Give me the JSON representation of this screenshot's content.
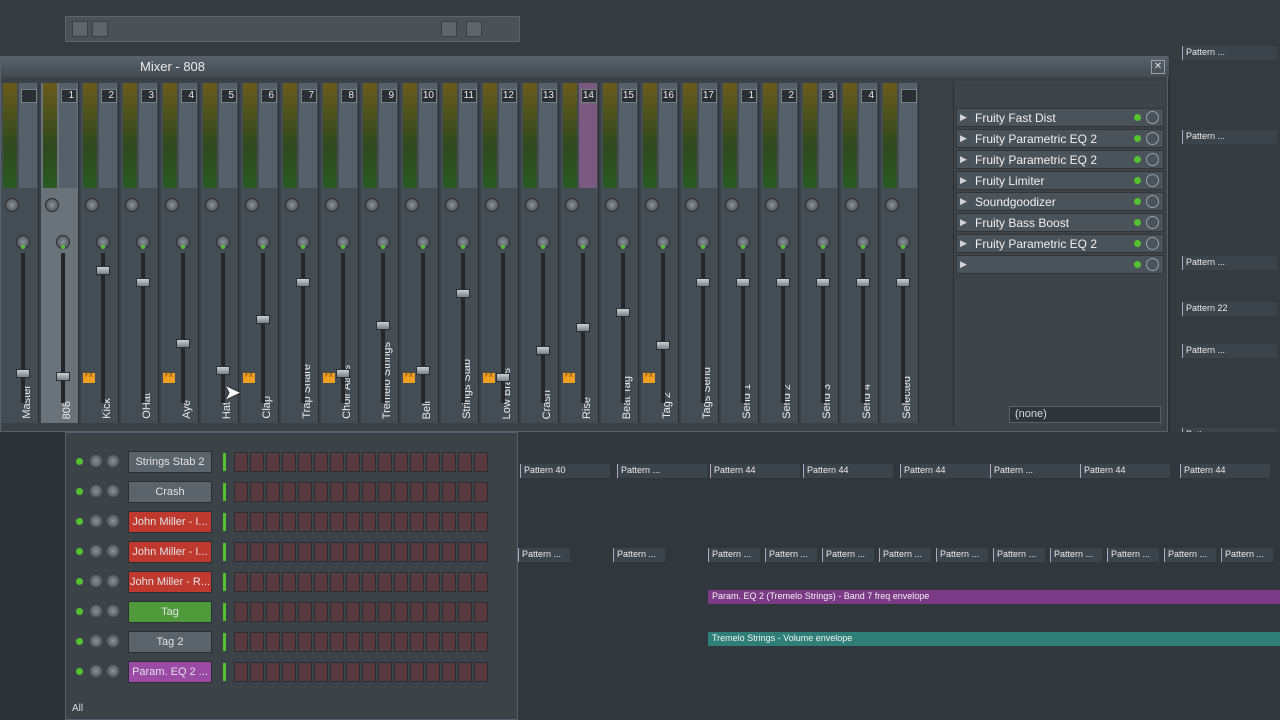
{
  "mixer": {
    "title": "Mixer - 808",
    "close_icon": "close-icon",
    "strips": [
      {
        "num": "",
        "name": "Master",
        "level": 0.2
      },
      {
        "num": "1",
        "name": "808",
        "level": 0.18
      },
      {
        "num": "2",
        "name": "Kick",
        "level": 0.91
      },
      {
        "num": "3",
        "name": "OHat",
        "level": 0.83
      },
      {
        "num": "4",
        "name": "Aye",
        "level": 0.41
      },
      {
        "num": "5",
        "name": "Hat",
        "level": 0.22
      },
      {
        "num": "6",
        "name": "Clap",
        "level": 0.57
      },
      {
        "num": "7",
        "name": "Trap Snare",
        "level": 0.83
      },
      {
        "num": "8",
        "name": "Choir Aahs",
        "level": 0.2
      },
      {
        "num": "9",
        "name": "Tremelo Strings",
        "level": 0.53
      },
      {
        "num": "10",
        "name": "Bell",
        "level": 0.22
      },
      {
        "num": "11",
        "name": "Strings Stab",
        "level": 0.75
      },
      {
        "num": "12",
        "name": "Low Brass",
        "level": 0.17
      },
      {
        "num": "13",
        "name": "Crash",
        "level": 0.36
      },
      {
        "num": "14",
        "name": "Rise",
        "level": 0.52
      },
      {
        "num": "15",
        "name": "Beat Tag",
        "level": 0.62
      },
      {
        "num": "16",
        "name": "Tag 2",
        "level": 0.39
      },
      {
        "num": "17",
        "name": "Tags Send",
        "level": 0.83
      },
      {
        "num": "1",
        "name": "Send 1",
        "level": 0.83
      },
      {
        "num": "2",
        "name": "Send 2",
        "level": 0.83
      },
      {
        "num": "3",
        "name": "Send 3",
        "level": 0.83
      },
      {
        "num": "4",
        "name": "Send 4",
        "level": 0.83
      },
      {
        "num": "",
        "name": "Selected",
        "level": 0.83
      }
    ],
    "fx_slots": [
      "Fruity Fast Dist",
      "Fruity Parametric EQ 2",
      "Fruity Parametric EQ 2",
      "Fruity Limiter",
      "Soundgoodizer",
      "Fruity Bass Boost",
      "Fruity Parametric EQ 2",
      ""
    ],
    "output": "(none)",
    "accent": "#f0a020"
  },
  "channel_rack": {
    "rows": [
      {
        "name": "Strings Stab 2",
        "color": "#5c646b"
      },
      {
        "name": "Crash",
        "color": "#5c646b"
      },
      {
        "name": "John Miller - I...",
        "color": "#c0392f"
      },
      {
        "name": "John Miller - I...",
        "color": "#c0392f"
      },
      {
        "name": "John Miller - R...",
        "color": "#c0392f"
      },
      {
        "name": "Tag",
        "color": "#4f9a3a"
      },
      {
        "name": "Tag 2",
        "color": "#5c646b"
      },
      {
        "name": "Param. EQ 2 ...",
        "color": "#9b4aa6"
      }
    ],
    "filter": "All"
  },
  "playlist": {
    "patterns_row1": [
      "Pattern 40",
      "Pattern ...",
      "Pattern 44",
      "Pattern 44",
      "Pattern 44",
      "Pattern ...",
      "Pattern 44",
      "Pattern 44"
    ],
    "patterns_row2": [
      "Pattern ...",
      "Pattern ...",
      "Pattern ...",
      "Pattern ...",
      "Pattern ...",
      "Pattern ...",
      "Pattern ...",
      "Pattern ...",
      "Pattern ...",
      "Pattern ...",
      "Pattern ...",
      "Pattern ..."
    ],
    "envelopes": [
      {
        "label": "Param. EQ 2 (Tremelo Strings) - Band 7 freq envelope",
        "color": "#7b3a86"
      },
      {
        "label": "Tremelo Strings - Volume envelope",
        "color": "#2f7f78"
      }
    ],
    "side_patterns": [
      "Pattern ...",
      "Pattern ...",
      "Pattern ...",
      "Pattern 22",
      "Pattern ...",
      "Pattern ..."
    ]
  }
}
